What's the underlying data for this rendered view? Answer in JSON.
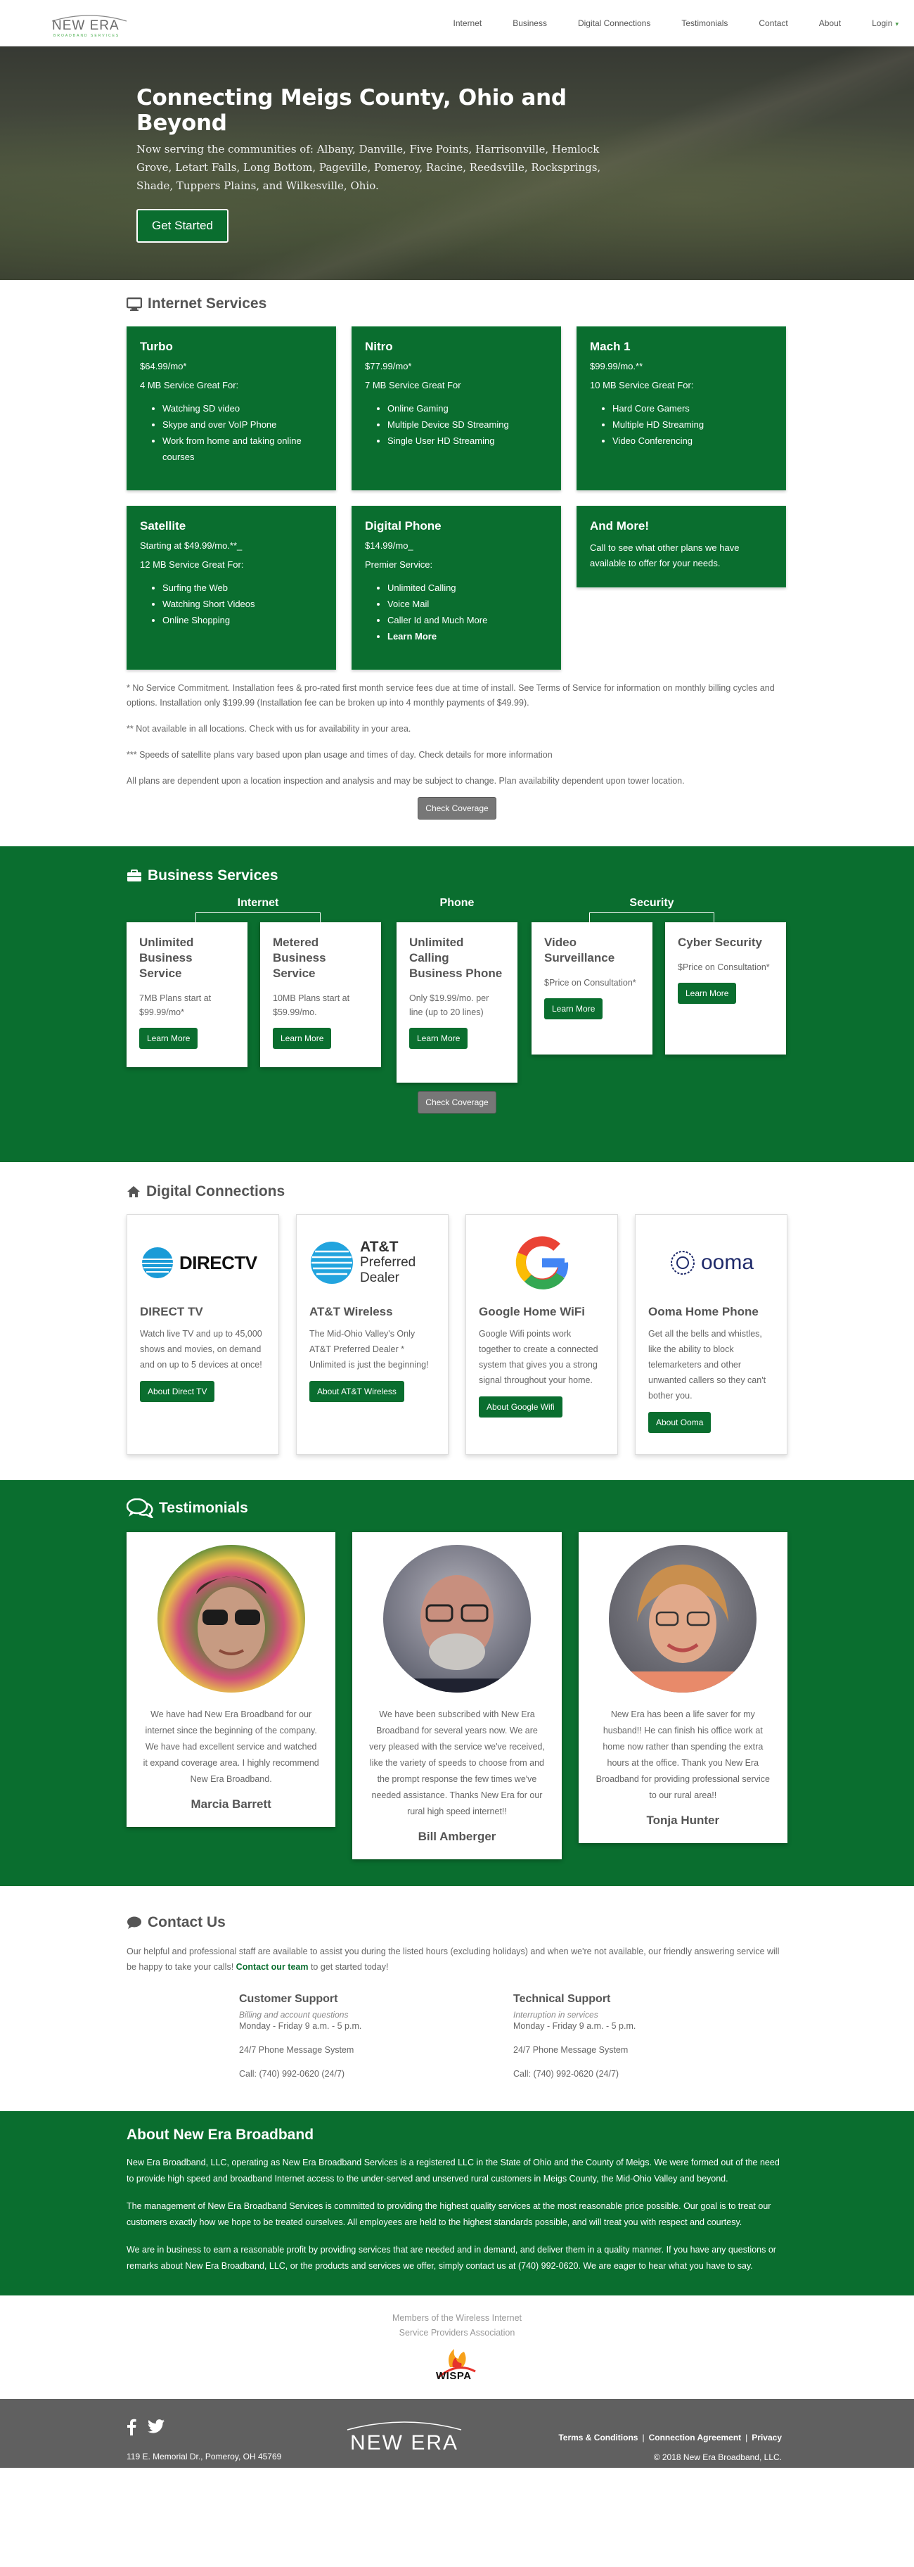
{
  "nav": {
    "logo_text": "NEW ERA",
    "logo_tagline": "BROADBAND SERVICES",
    "items": [
      "Internet",
      "Business",
      "Digital Connections",
      "Testimonials",
      "Contact",
      "About",
      "Login"
    ]
  },
  "hero": {
    "title": "Connecting Meigs County, Ohio and Beyond",
    "text": "Now serving the communities of: Albany, Danville, Five Points, Harrisonville, Hemlock Grove, Letart Falls, Long Bottom, Pageville, Pomeroy, Racine, Reedsville, Rocksprings, Shade, Tuppers Plains, and Wilkesville, Ohio.",
    "button": "Get Started"
  },
  "internet": {
    "title": "Internet Services",
    "plans": [
      {
        "name": "Turbo",
        "price": "$64.99/mo*",
        "sub": "4 MB Service Great For:",
        "features": [
          "Watching SD video",
          "Skype and over VoIP Phone",
          "Work from home and taking online courses"
        ]
      },
      {
        "name": "Nitro",
        "price": "$77.99/mo*",
        "sub": "7 MB Service Great For",
        "features": [
          "Online Gaming",
          "Multiple Device SD Streaming",
          "Single User HD Streaming"
        ]
      },
      {
        "name": "Mach 1",
        "price": "$99.99/mo.**",
        "sub": "10 MB Service Great For:",
        "features": [
          "Hard Core Gamers",
          "Multiple HD Streaming",
          "Video Conferencing"
        ]
      },
      {
        "name": "Satellite",
        "price": "Starting at $49.99/mo.**_",
        "sub": "12 MB Service Great For:",
        "features": [
          "Surfing the Web",
          "Watching Short Videos",
          "Online Shopping"
        ]
      },
      {
        "name": "Digital Phone",
        "price": "$14.99/mo_",
        "sub": "Premier Service:",
        "features": [
          "Unlimited Calling",
          "Voice Mail",
          "Caller Id and Much More",
          "Learn More"
        ]
      },
      {
        "name": "And More!",
        "text": "Call to see what other plans we have available to offer for your needs."
      }
    ],
    "notes": [
      "* No Service Commitment. Installation fees & pro-rated first month service fees due at time of install. See Terms of Service for information on monthly billing cycles and options. Installation only $199.99 (Installation fee can be broken up into 4 monthly payments of $49.99).",
      "** Not available in all locations. Check with us for availability in your area.",
      "*** Speeds of satellite plans vary based upon plan usage and times of day. Check details for more information",
      "All plans are dependent upon a location inspection and analysis and may be subject to change. Plan availability dependent upon tower location."
    ],
    "button": "Check Coverage"
  },
  "business": {
    "title": "Business Services",
    "groups": [
      "Internet",
      "Phone",
      "Security"
    ],
    "cards": [
      {
        "name": "Unlimited Business Service",
        "text": "7MB Plans start at $99.99/mo*",
        "button": "Learn More"
      },
      {
        "name": "Metered Business Service",
        "text": "10MB Plans start at $59.99/mo.",
        "button": "Learn More"
      },
      {
        "name": "Unlimited Calling Business Phone",
        "text": "Only $19.99/mo. per line (up to 20 lines)",
        "button": "Learn More"
      },
      {
        "name": "Video Surveillance",
        "text": "$Price on Consultation*",
        "button": "Learn More"
      },
      {
        "name": "Cyber Security",
        "text": "$Price on Consultation*",
        "button": "Learn More"
      }
    ],
    "button": "Check Coverage"
  },
  "digital": {
    "title": "Digital Connections",
    "cards": [
      {
        "logo": "DIRECTV",
        "name": "DIRECT TV",
        "text": "Watch live TV and up to 45,000 shows and movies, on demand and on up to 5 devices at once!",
        "button": "About Direct TV"
      },
      {
        "logo_line1": "AT&T",
        "logo_line2": "Preferred",
        "logo_line3": "Dealer",
        "name": "AT&T Wireless",
        "text": "The Mid-Ohio Valley's Only AT&T Preferred Dealer * Unlimited is just the beginning!",
        "button": "About AT&T Wireless"
      },
      {
        "logo": "G",
        "name": "Google Home WiFi",
        "text": "Google Wifi points work together to create a connected system that gives you a strong signal throughout your home.",
        "button": "About Google Wifi"
      },
      {
        "logo": "ooma",
        "name": "Ooma Home Phone",
        "text": "Get all the bells and whistles, like the ability to block telemarketers and other unwanted callers so they can't bother you.",
        "button": "About Ooma"
      }
    ]
  },
  "testimonials": {
    "title": "Testimonials",
    "items": [
      {
        "text": "We have had New Era Broadband for our internet since the beginning of the company. We have had excellent service and watched it expand coverage area. I highly recommend New Era Broadband.",
        "name": "Marcia Barrett"
      },
      {
        "text": "We have been subscribed with New Era Broadband for several years now. We are very pleased with the service we've received, like the variety of speeds to choose from and the prompt response the few times we've needed assistance. Thanks New Era for our rural high speed internet!!",
        "name": "Bill Amberger"
      },
      {
        "text": "New Era has been a life saver for my husband!! He can finish his office work at home now rather than spending the extra hours at the office. Thank you New Era Broadband for providing professional service to our rural area!!",
        "name": "Tonja Hunter"
      }
    ]
  },
  "contact": {
    "title": "Contact Us",
    "intro_before": "Our helpful and professional staff are available to assist you during the listed hours (excluding holidays) and when we're not available, our friendly answering service will be happy to take your calls!",
    "intro_link": "Contact our team",
    "intro_after": "to get started today!",
    "customer": {
      "title": "Customer Support",
      "sub": "Billing and account questions",
      "hours": "Monday - Friday 9 a.m. - 5 p.m.",
      "system": "24/7 Phone Message System",
      "call": "Call: (740) 992-0620 (24/7)"
    },
    "technical": {
      "title": "Technical Support",
      "sub": "Interruption in services",
      "hours": "Monday - Friday 9 a.m. - 5 p.m.",
      "system": "24/7 Phone Message System",
      "call": "Call: (740) 992-0620 (24/7)"
    }
  },
  "about": {
    "title": "About New Era Broadband",
    "paragraphs": [
      "New Era Broadband, LLC, operating as New Era Broadband Services is a registered LLC in the State of Ohio and the County of Meigs. We were formed out of the need to provide high speed and broadband Internet access to the under-served and unserved rural customers in Meigs County, the Mid-Ohio Valley and beyond.",
      "The management of New Era Broadband Services is committed to providing the highest quality services at the most reasonable price possible. Our goal is to treat our customers exactly how we hope to be treated ourselves. All employees are held to the highest standards possible, and will treat you with respect and courtesy.",
      "We are in business to earn a reasonable profit by providing services that are needed and in demand, and deliver them in a quality manner. If you have any questions or remarks about New Era Broadband, LLC, or the products and services we offer, simply contact us at (740) 992-0620. We are eager to hear what you have to say."
    ]
  },
  "members": {
    "line1": "Members of the Wireless Internet",
    "line2": "Service Providers Association",
    "logo": "WISPA"
  },
  "footer": {
    "address": "119 E. Memorial Dr., Pomeroy, OH 45769",
    "logo": "NEW ERA",
    "links": [
      "Terms & Conditions",
      "Connection Agreement",
      "Privacy"
    ],
    "copyright": "© 2018 New Era Broadband, LLC."
  },
  "colors": {
    "brand_green": "#0a6e2f",
    "footer_gray": "#606060"
  }
}
